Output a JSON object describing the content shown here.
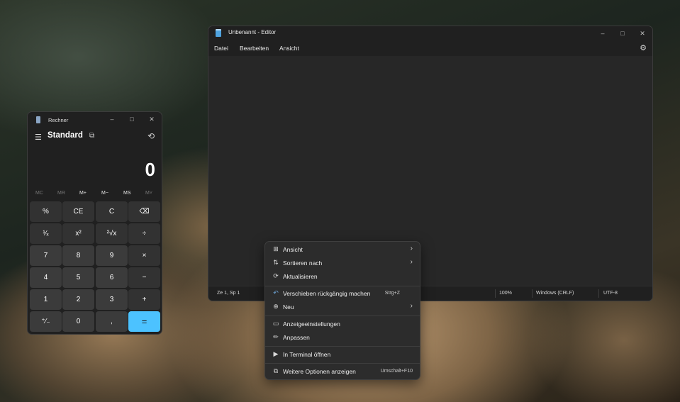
{
  "editor": {
    "title": "Unbenannt - Editor",
    "menu": [
      "Datei",
      "Bearbeiten",
      "Ansicht"
    ],
    "status": {
      "position": "Ze 1, Sp 1",
      "zoom": "100%",
      "line_ending": "Windows (CRLF)",
      "encoding": "UTF-8"
    }
  },
  "calculator": {
    "title": "Rechner",
    "mode": "Standard",
    "display": "0",
    "memory": [
      "MC",
      "MR",
      "M+",
      "M−",
      "MS",
      "M˅"
    ],
    "keys": [
      [
        "%",
        "CE",
        "C",
        "⌫"
      ],
      [
        "¹⁄ₓ",
        "x²",
        "²√x",
        "÷"
      ],
      [
        "7",
        "8",
        "9",
        "×"
      ],
      [
        "4",
        "5",
        "6",
        "−"
      ],
      [
        "1",
        "2",
        "3",
        "+"
      ],
      [
        "⁺⁄₋",
        "0",
        ",",
        "="
      ]
    ]
  },
  "context_menu": {
    "items": [
      {
        "icon": "grid-icon",
        "label": "Ansicht",
        "submenu": true
      },
      {
        "icon": "sort-icon",
        "label": "Sortieren nach",
        "submenu": true
      },
      {
        "icon": "refresh-icon",
        "label": "Aktualisieren"
      },
      {
        "icon": "undo-icon",
        "label": "Verschieben rückgängig machen",
        "shortcut": "Strg+Z"
      },
      {
        "icon": "new-icon",
        "label": "Neu",
        "submenu": true
      },
      {
        "icon": "display-icon",
        "label": "Anzeigeeinstellungen"
      },
      {
        "icon": "brush-icon",
        "label": "Anpassen"
      },
      {
        "icon": "terminal-icon",
        "label": "In Terminal öffnen"
      },
      {
        "icon": "more-options-icon",
        "label": "Weitere Optionen anzeigen",
        "shortcut": "Umschalt+F10"
      }
    ]
  },
  "colors": {
    "accent": "#4cc2ff",
    "window_bg": "#202020",
    "menu_bg": "#2c2c2c"
  }
}
